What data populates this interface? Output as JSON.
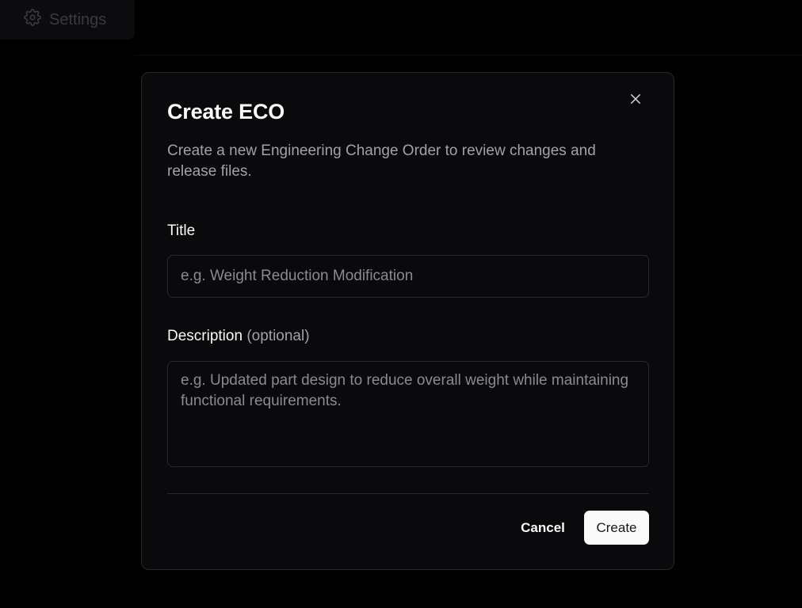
{
  "background": {
    "settings_label": "Settings",
    "settings_icon": "gear-icon"
  },
  "dialog": {
    "title": "Create ECO",
    "description": "Create a new Engineering Change Order to review changes and release files.",
    "close_icon": "close-icon",
    "title_field": {
      "label": "Title",
      "value": "",
      "placeholder": "e.g. Weight Reduction Modification"
    },
    "description_field": {
      "label": "Description",
      "optional_label": "(optional)",
      "value": "",
      "placeholder": "e.g. Updated part design to reduce overall weight while maintaining functional requirements."
    },
    "cancel_label": "Cancel",
    "create_label": "Create"
  },
  "colors": {
    "page_background": "#000000",
    "dialog_background": "#0a0a0c",
    "border": "#27272a",
    "text_primary": "#fafafa",
    "text_muted": "#a1a1aa",
    "primary_button_bg": "#fafafa",
    "primary_button_text": "#18181b"
  }
}
